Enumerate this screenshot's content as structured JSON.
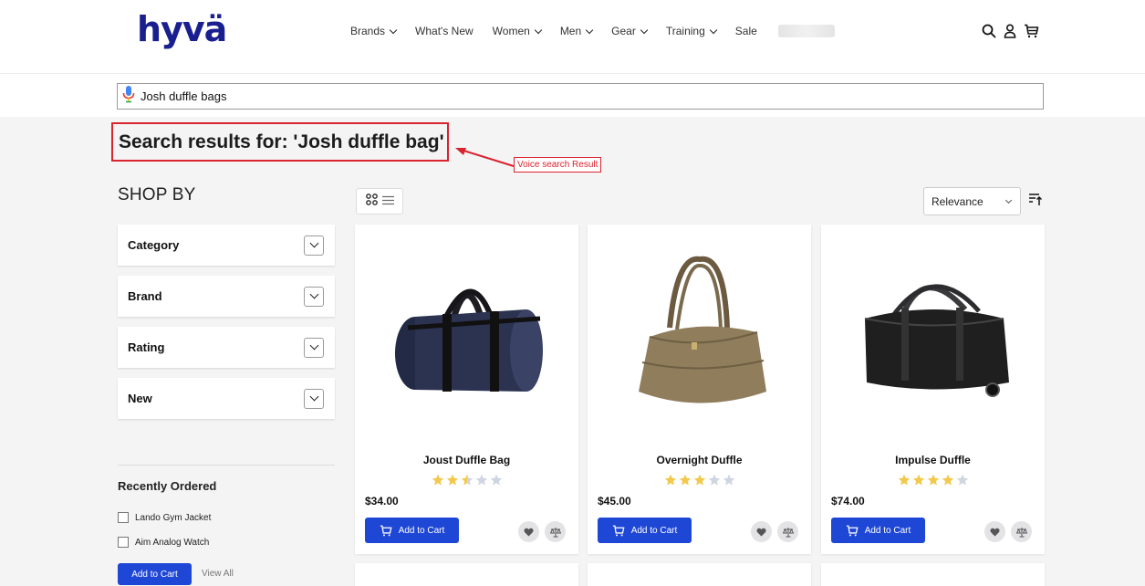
{
  "header": {
    "logo_text": "hyvä",
    "nav": [
      {
        "label": "Brands",
        "dropdown": true
      },
      {
        "label": "What's New",
        "dropdown": false
      },
      {
        "label": "Women",
        "dropdown": true
      },
      {
        "label": "Men",
        "dropdown": true
      },
      {
        "label": "Gear",
        "dropdown": true
      },
      {
        "label": "Training",
        "dropdown": true
      },
      {
        "label": "Sale",
        "dropdown": false
      }
    ],
    "icons": [
      "search-icon",
      "user-icon",
      "cart-icon"
    ]
  },
  "search": {
    "value": "Josh duffle bags",
    "icon": "microphone-icon"
  },
  "results": {
    "title": "Search results for: 'Josh duffle bag'",
    "annotation": "Voice search Result",
    "annotation_color": "#d9232e"
  },
  "sidebar": {
    "shop_by": "SHOP BY",
    "filters": [
      {
        "label": "Category"
      },
      {
        "label": "Brand"
      },
      {
        "label": "Rating"
      },
      {
        "label": "New"
      }
    ],
    "recently_ordered": {
      "title": "Recently Ordered",
      "items": [
        {
          "label": "Lando Gym Jacket",
          "checked": false
        },
        {
          "label": "Aim Analog Watch",
          "checked": false
        }
      ],
      "add_to_cart": "Add to Cart",
      "view_all": "View All"
    }
  },
  "toolbar": {
    "view_modes": [
      "grid-icon",
      "list-icon"
    ],
    "sort": {
      "selected": "Relevance"
    },
    "sort_direction_icon": "sort-ascending-icon"
  },
  "products": [
    {
      "name": "Joust Duffle Bag",
      "price": "$34.00",
      "rating": 2.5,
      "add_to_cart": "Add to Cart",
      "bag_color": "#2b3350"
    },
    {
      "name": "Overnight Duffle",
      "price": "$45.00",
      "rating": 3,
      "add_to_cart": "Add to Cart",
      "bag_color": "#8f7d5c"
    },
    {
      "name": "Impulse Duffle",
      "price": "$74.00",
      "rating": 4,
      "add_to_cart": "Add to Cart",
      "bag_color": "#1f1f20"
    }
  ],
  "colors": {
    "brand": "#1a1f8f",
    "primary_button": "#1f47d6",
    "star_filled": "#f2c94c",
    "star_empty": "#cfd6e0"
  }
}
